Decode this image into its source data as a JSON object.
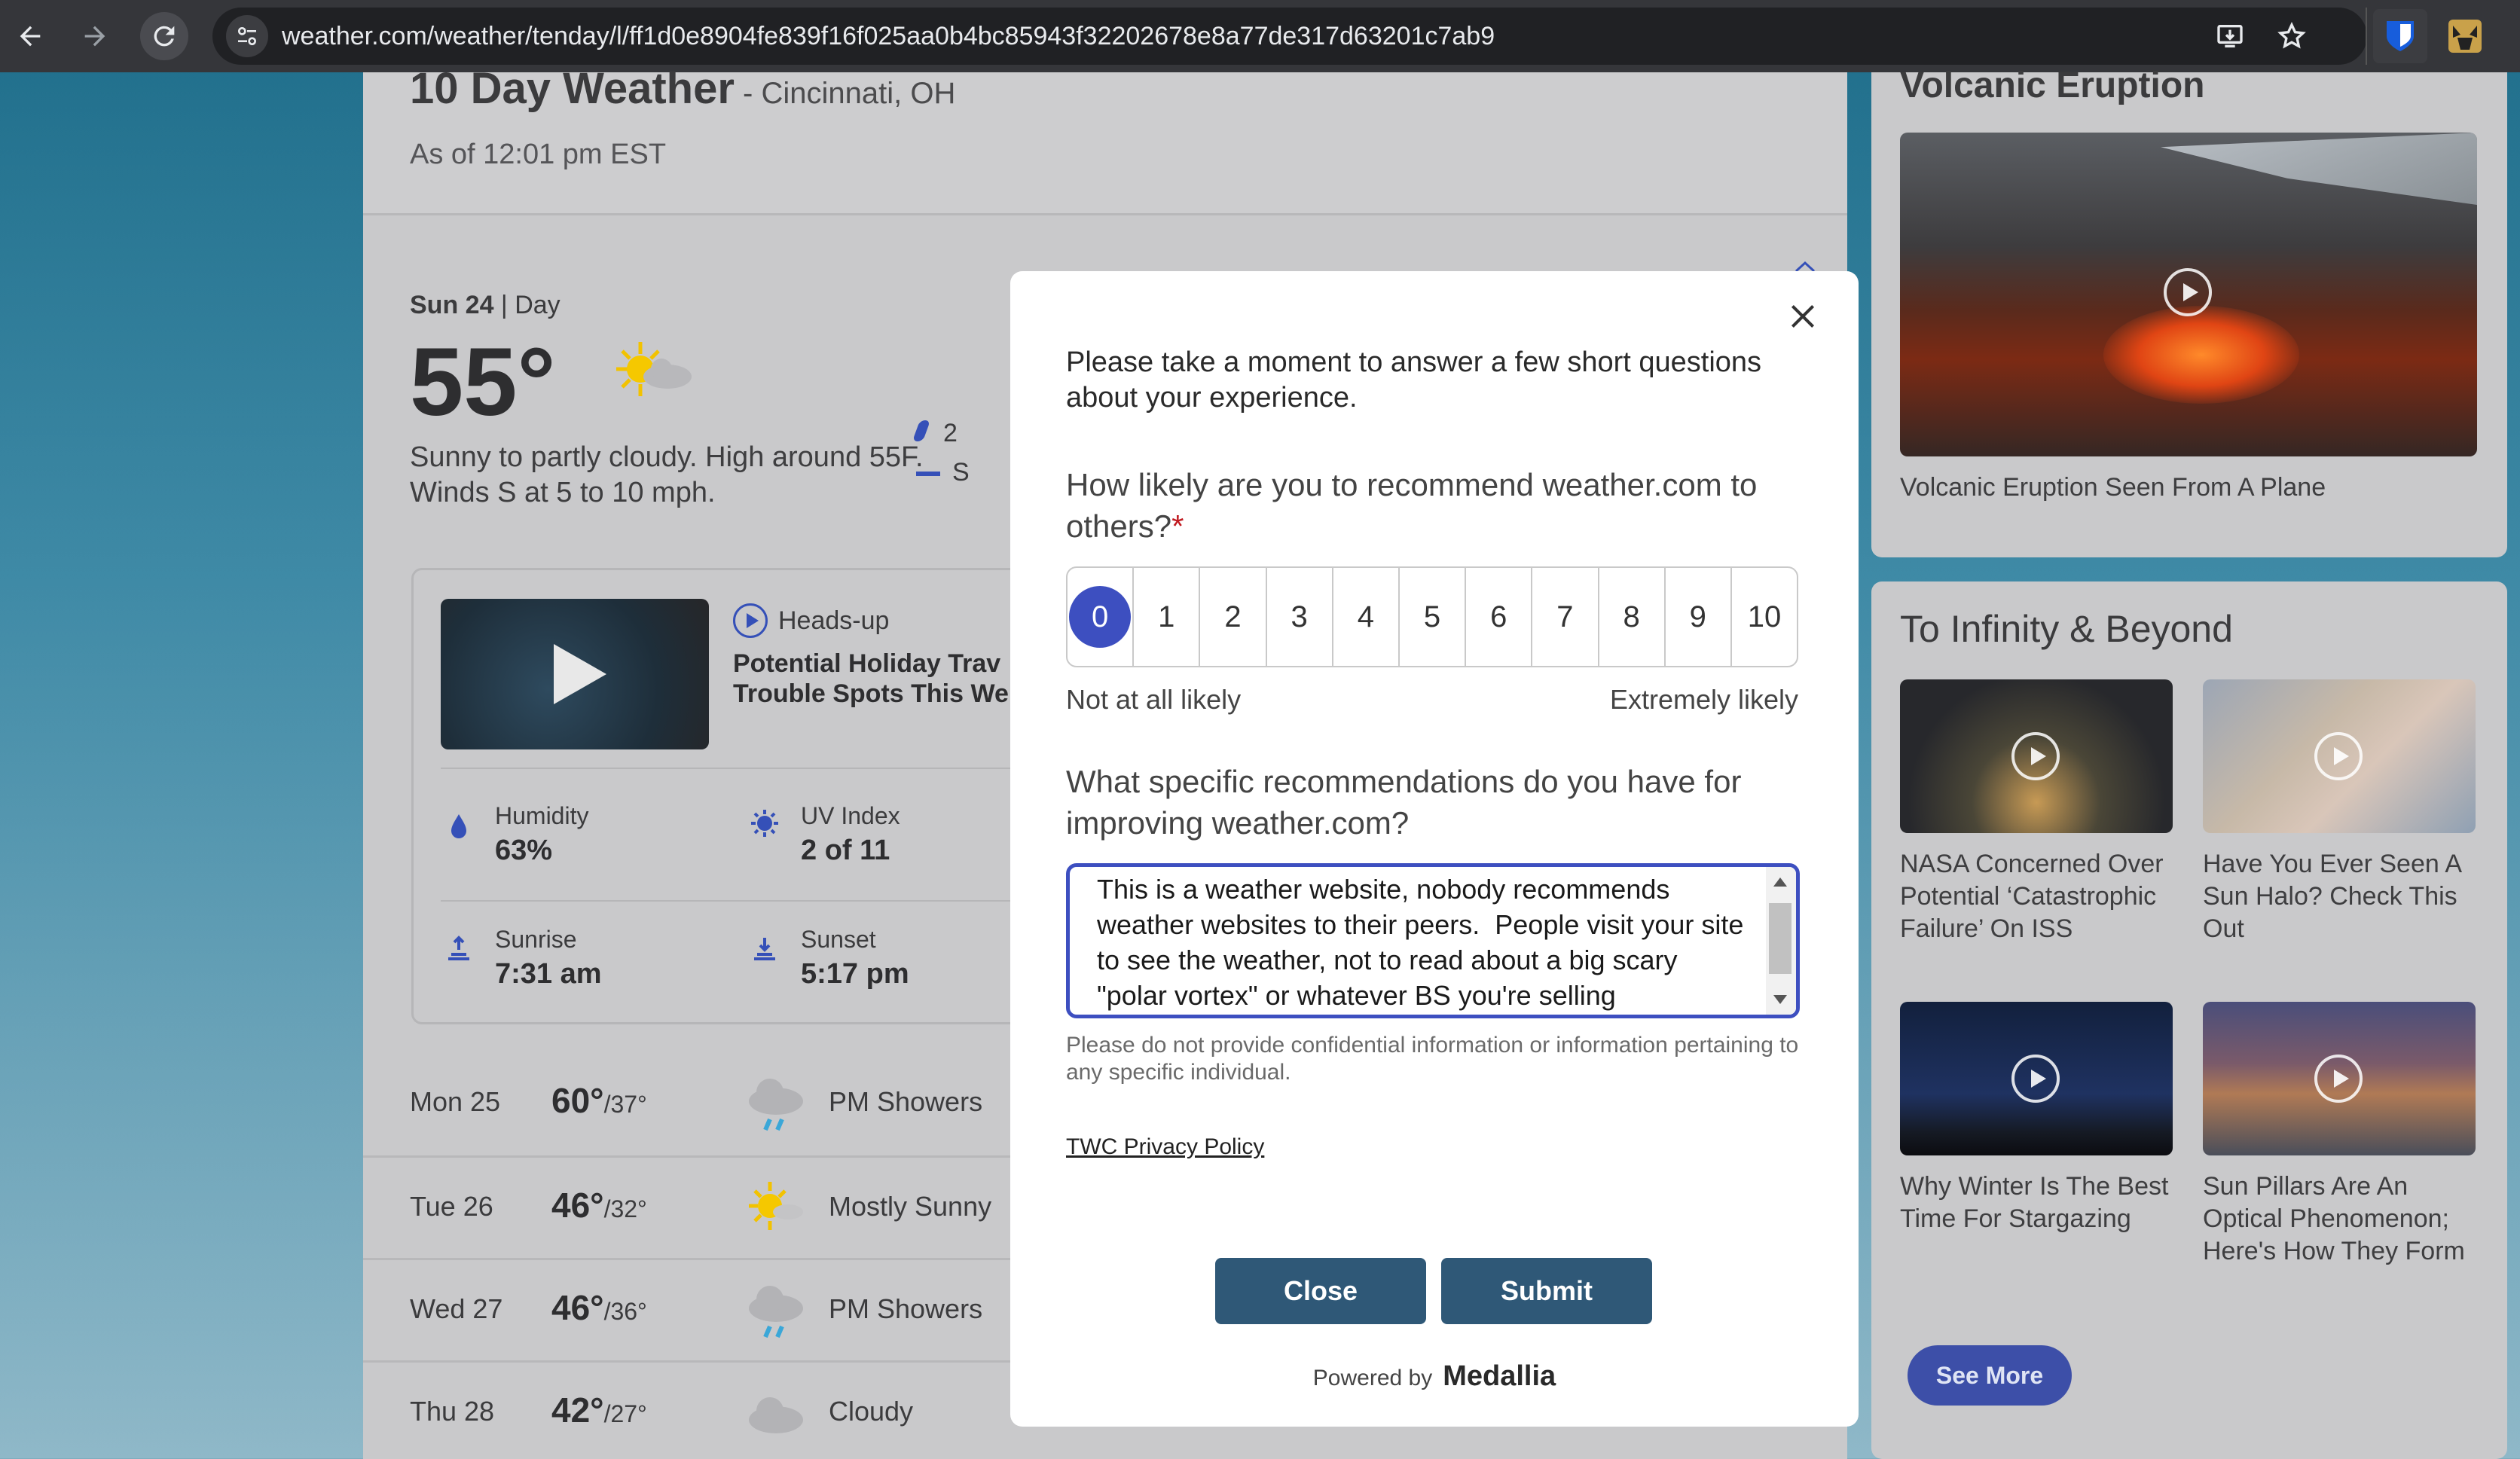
{
  "browser": {
    "url": "weather.com/weather/tenday/l/ff1d0e8904fe839f16f025aa0b4bc85943f32202678e8a77de317d63201c7ab9"
  },
  "page": {
    "title": "10 Day Weather",
    "location": " - Cincinnati, OH",
    "as_of": "As of 12:01 pm EST"
  },
  "today": {
    "day": "Sun 24",
    "part": " | Day",
    "temp": "55°",
    "narrative": "Sunny to partly cloudy. High around 55F. Winds S at 5 to 10 mph.",
    "side_stat_1": "2",
    "side_stat_2": "S"
  },
  "video_card": {
    "tag": "Heads-up",
    "title_line1": "Potential Holiday Trav",
    "title_line2": "Trouble Spots This We",
    "humidity_label": "Humidity",
    "humidity_value": "63%",
    "uv_label": "UV Index",
    "uv_value": "2 of 11",
    "sunrise_label": "Sunrise",
    "sunrise_value": "7:31 am",
    "sunset_label": "Sunset",
    "sunset_value": "5:17 pm"
  },
  "forecast": [
    {
      "day": "Mon 25",
      "hi": "60°",
      "lo": "/37°",
      "cond": "PM Showers",
      "icon": "rain-cloud-icon"
    },
    {
      "day": "Tue 26",
      "hi": "46°",
      "lo": "/32°",
      "cond": "Mostly Sunny",
      "icon": "sun-icon"
    },
    {
      "day": "Wed 27",
      "hi": "46°",
      "lo": "/36°",
      "cond": "PM Showers",
      "icon": "rain-cloud-icon"
    },
    {
      "day": "Thu 28",
      "hi": "42°",
      "lo": "/27°",
      "cond": "Cloudy",
      "icon": "cloud-icon"
    }
  ],
  "sidebar": {
    "card1_heading": "Volcanic Eruption",
    "card1_caption": "Volcanic Eruption Seen From A Plane",
    "card2_heading": "To Infinity & Beyond",
    "items": [
      {
        "caption": "NASA Concerned Over Potential ‘Catastrophic Failure’ On ISS"
      },
      {
        "caption": "Have You Ever Seen A Sun Halo? Check This Out"
      },
      {
        "caption": "Why Winter Is The Best Time For Stargazing"
      },
      {
        "caption": "Sun Pillars Are An Optical Phenomenon; Here's How They Form"
      }
    ],
    "see_more": "See More"
  },
  "survey": {
    "intro": "Please take a moment to answer a few short questions about your experience.",
    "q1": "How likely are you to recommend weather.com to others?",
    "q1_required": "*",
    "scale": [
      "0",
      "1",
      "2",
      "3",
      "4",
      "5",
      "6",
      "7",
      "8",
      "9",
      "10"
    ],
    "selected": "0",
    "low_label": "Not at all likely",
    "high_label": "Extremely likely",
    "q2": "What specific recommendations do you have for improving weather.com?",
    "answer": "This is a weather website, nobody recommends weather websites to their peers.  People visit your site to see the weather, not to read about a big scary \"polar vortex\" or whatever BS you're selling",
    "disclaimer": "Please do not provide confidential information or information pertaining to any specific individual.",
    "privacy_link": "TWC Privacy Policy",
    "close_label": "Close",
    "submit_label": "Submit",
    "powered_by": "Powered by",
    "brand": "Medallia"
  },
  "colors": {
    "accent": "#3d4fc0",
    "button": "#2f5877",
    "required": "#c0191f"
  }
}
